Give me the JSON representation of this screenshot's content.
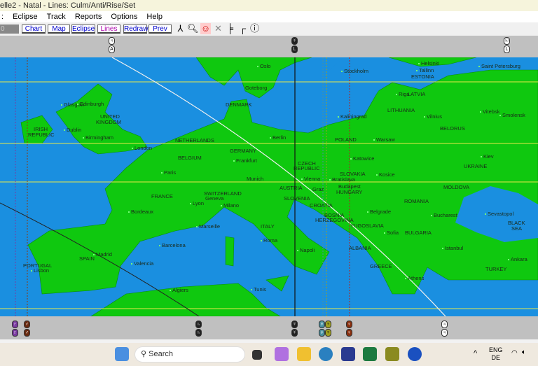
{
  "window": {
    "title": "elle2 - Natal - Lines: Culm/Anti/Rise/Set"
  },
  "menu": [
    "Eclipse",
    "Track",
    "Reports",
    "Options",
    "Help"
  ],
  "toolbar": {
    "field_value": "0",
    "buttons": [
      "Chart",
      "Map",
      "Eclipse",
      "Lines",
      "Redraw",
      "Prev"
    ],
    "icons": [
      "person-icon",
      "zoom-icon",
      "face-icon",
      "cross-icon",
      "pin-icon",
      "chart-point-icon",
      "info-icon"
    ]
  },
  "map": {
    "labels": [
      "Oslo",
      "Stockholm",
      "Helsinki",
      "Saint Petersburg",
      "Tallinn",
      "ESTONIA",
      "Goteborg",
      "Riga",
      "LATVIA",
      "Glasgow",
      "Edinburgh",
      "DENMARK",
      "LITHUANIA",
      "Vitebsk",
      "Smolensk",
      "UNITED",
      "KINGDOM",
      "Kaliningrad",
      "Vilnius",
      "IRISH",
      "REPUBLIC",
      "Dublin",
      "BELORUS",
      "Birmingham",
      "Berlin",
      "POLAND",
      "Warsaw",
      "NETHERLANDS",
      "London",
      "GERMANY",
      "Kiev",
      "BELGIUM",
      "Frankfurt",
      "Katowice",
      "CZECH",
      "REPUBLIC",
      "UKRAINE",
      "Paris",
      "SLOVAKIA",
      "Kosice",
      "Munich",
      "Vienna",
      "Bratislava",
      "MOLDOVA",
      "AUSTRIA",
      "Graz",
      "Budapest",
      "HUNGARY",
      "SWITZERLAND",
      "Geneva",
      "FRANCE",
      "Lyon",
      "SLOVENIA",
      "CROATIA",
      "ROMANIA",
      "Milano",
      "Bordeaux",
      "BOSNIA",
      "HERZEGOVINA",
      "Belgrade",
      "Bucharest",
      "Sevastopol",
      "YUGOSLAVIA",
      "ITALY",
      "Marseille",
      "Sofia",
      "BULGARIA",
      "BLACK",
      "SEA",
      "Roma",
      "Barcelona",
      "ALBANIA",
      "Napoli",
      "Istanbul",
      "Madrid",
      "SPAIN",
      "Ankara",
      "Valencia",
      "GREECE",
      "TURKEY",
      "PORTUGAL",
      "Lisbon",
      "Athens",
      "Algiers",
      "Tunis"
    ],
    "colors": {
      "sea": "#1a8fe0",
      "land": "#0fc80f"
    }
  },
  "taskbar": {
    "search_placeholder": "Search",
    "lang": "ENG",
    "region": "DE"
  }
}
